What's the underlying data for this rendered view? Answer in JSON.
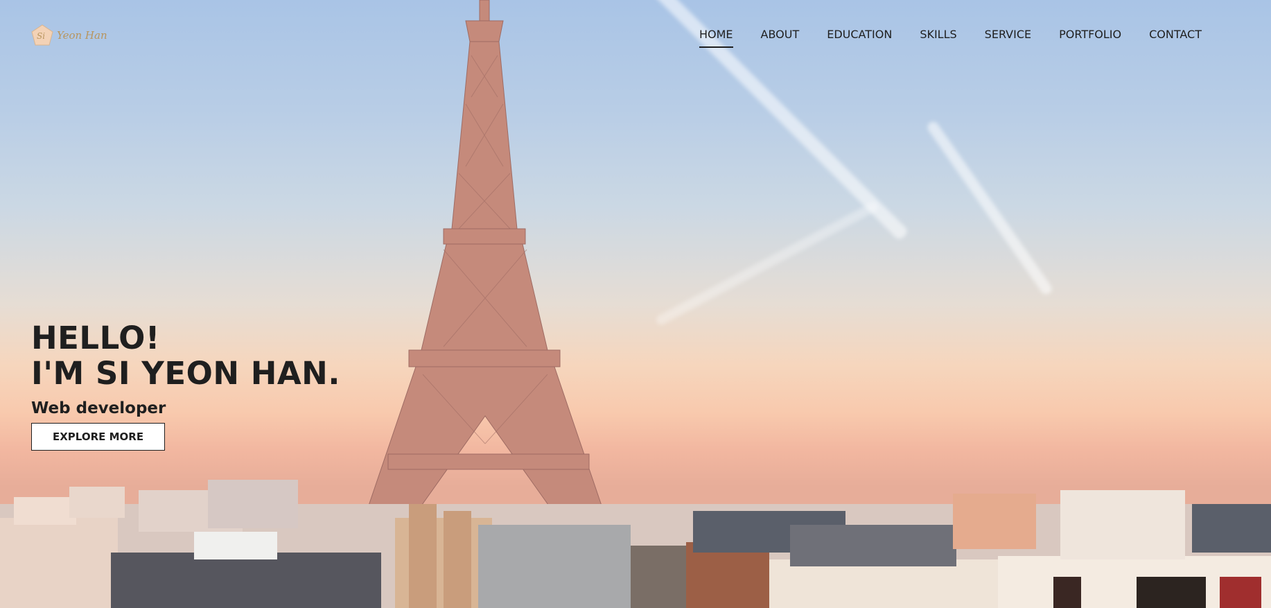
{
  "logo": {
    "text": "Yeon Han",
    "monogram": "Si"
  },
  "nav": {
    "items": [
      "HOME",
      "ABOUT",
      "EDUCATION",
      "SKILLS",
      "SERVICE",
      "PORTFOLIO",
      "CONTACT"
    ],
    "active": "HOME"
  },
  "hero": {
    "line1": "HELLO!",
    "line2": "I'M SI YEON HAN.",
    "subtitle": "Web developer",
    "button_label": "EXPLORE MORE"
  },
  "colors": {
    "text": "#1f1f1f",
    "logo_gold": "#b8955e",
    "sky_top": "#a9c4e6",
    "sky_bottom": "#f2b7a0"
  }
}
